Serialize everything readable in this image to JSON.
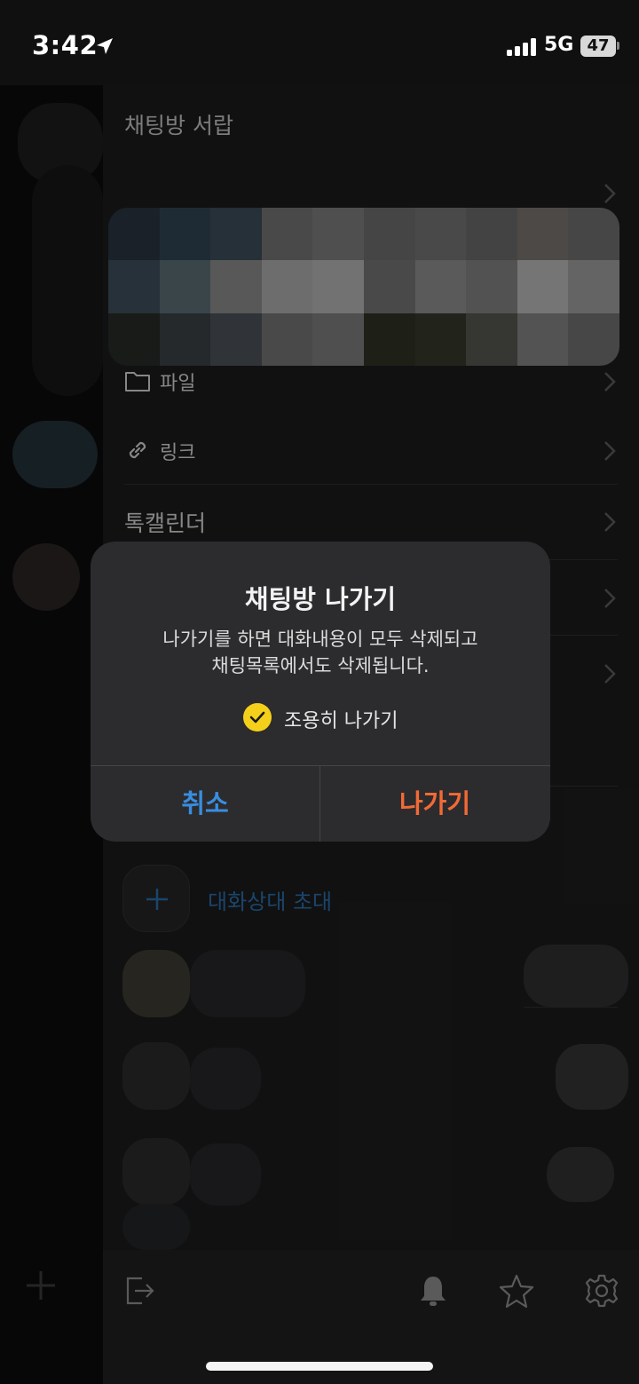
{
  "status_bar": {
    "time": "3:42",
    "network": "5G",
    "battery": "47"
  },
  "drawer": {
    "title": "채팅방 서랍",
    "rows": [
      {
        "label": "파일",
        "icon": "folder-icon"
      },
      {
        "label": "링크",
        "icon": "link-icon"
      },
      {
        "label": "톡캘린더",
        "icon": ""
      }
    ],
    "invite_label": "대화상대 초대"
  },
  "dialog": {
    "title": "채팅방 나가기",
    "message_line1": "나가기를 하면 대화내용이 모두 삭제되고",
    "message_line2": "채팅목록에서도 삭제됩니다.",
    "checkbox_label": "조용히 나가기",
    "checkbox_checked": true,
    "cancel_label": "취소",
    "leave_label": "나가기"
  },
  "colors": {
    "accent_blue": "#3a8ddf",
    "leave_orange": "#f26a35",
    "check_yellow": "#f5d01b"
  }
}
